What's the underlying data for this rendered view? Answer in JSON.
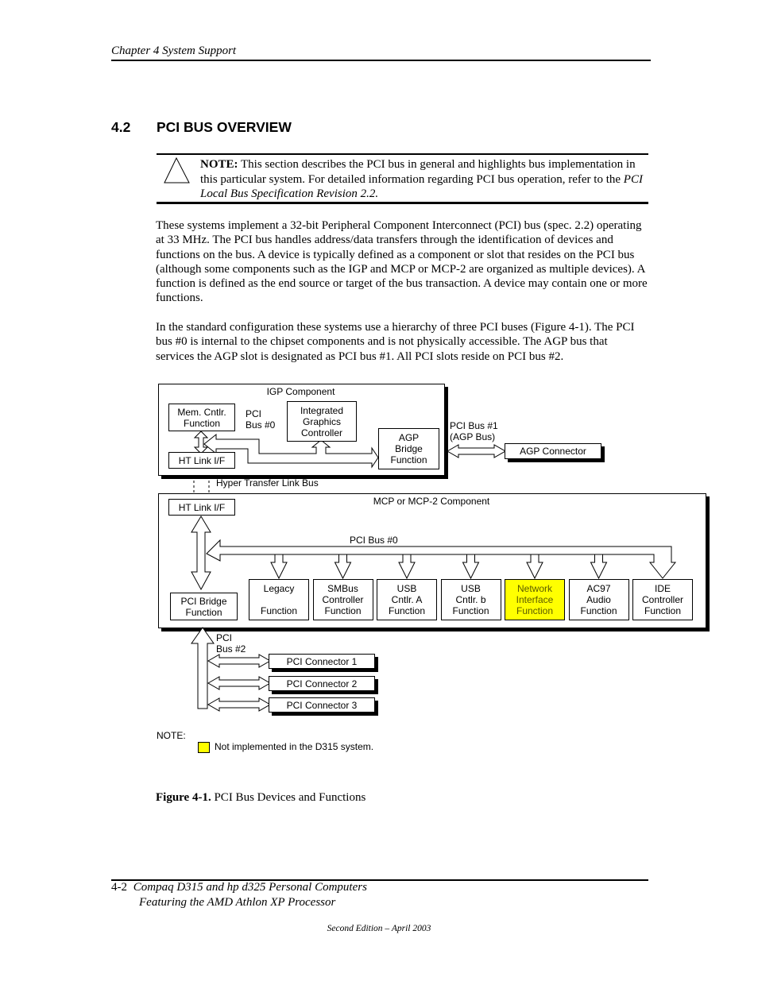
{
  "header": {
    "chapter": "Chapter 4  System Support"
  },
  "section": {
    "number": "4.2",
    "title": "PCI BUS OVERVIEW"
  },
  "note": {
    "icon": "caution-triangle-icon",
    "label": "NOTE:",
    "text_before": "  This section describes the PCI bus in general and highlights bus implementation in this particular system. For detailed information regarding PCI bus operation, refer to the ",
    "reference": "PCI Local Bus Specification Revision 2.2."
  },
  "paragraphs": [
    "These systems implement a 32-bit Peripheral Component Interconnect (PCI) bus (spec. 2.2) operating at 33 MHz. The PCI bus handles address/data transfers through the identification of devices and functions on the bus. A device is typically defined as a component or slot that resides on the PCI bus (although some components such as the IGP and MCP or MCP-2 are organized as multiple devices). A function is defined as the end source or target of the bus transaction. A device may contain one or more functions.",
    "In the standard configuration these systems use a hierarchy of three PCI buses (Figure 4-1). The PCI bus #0 is internal to the chipset components and is not physically accessible. The AGP bus that services the AGP slot is designated as PCI bus #1. All PCI slots reside on PCI bus #2."
  ],
  "diagram": {
    "igp": {
      "title": "IGP Component",
      "mem_cntlr": [
        "Mem. Cntlr.",
        "Function"
      ],
      "pci_bus0": [
        "PCI",
        "Bus #0"
      ],
      "graphics": [
        "Integrated",
        "Graphics",
        "Controller"
      ],
      "agp_bridge": [
        "AGP",
        "Bridge",
        "Function"
      ],
      "ht_link": "HT Link I/F"
    },
    "pci_bus1": [
      "PCI Bus #1",
      "(AGP Bus)"
    ],
    "agp_connector": "AGP Connector",
    "hyper_transfer": "Hyper Transfer Link Bus",
    "mcp": {
      "title": "MCP or MCP-2 Component",
      "ht_link": "HT Link I/F",
      "pci_bus0": "PCI Bus #0",
      "pci_bridge": [
        "PCI Bridge",
        "Function"
      ],
      "functions": [
        {
          "lines": [
            "Legacy",
            "",
            "Function"
          ],
          "highlight": false
        },
        {
          "lines": [
            "SMBus",
            "Controller",
            "Function"
          ],
          "highlight": false
        },
        {
          "lines": [
            "USB",
            "Cntlr. A",
            "Function"
          ],
          "highlight": false
        },
        {
          "lines": [
            "USB",
            "Cntlr. b",
            "Function"
          ],
          "highlight": false
        },
        {
          "lines": [
            "Network",
            "Interface",
            "Function"
          ],
          "highlight": true
        },
        {
          "lines": [
            "AC97",
            "Audio",
            "Function"
          ],
          "highlight": false
        },
        {
          "lines": [
            "IDE",
            "Controller",
            "Function"
          ],
          "highlight": false
        }
      ]
    },
    "pci_bus2": [
      "PCI",
      "Bus #2"
    ],
    "connectors": [
      "PCI Connector 1",
      "PCI Connector 2",
      "PCI Connector 3"
    ],
    "legend_note": "NOTE:",
    "legend_text": "Not implemented in the D315 system.",
    "highlight_color": "#FFFF00"
  },
  "figure": {
    "label": "Figure 4-1.",
    "caption": "  PCI Bus Devices and Functions"
  },
  "footer": {
    "page": "4-2",
    "line1": "Compaq D315 and hp d325 Personal Computers",
    "line2": "Featuring the AMD Athlon XP Processor",
    "edition": "Second Edition – April 2003"
  }
}
